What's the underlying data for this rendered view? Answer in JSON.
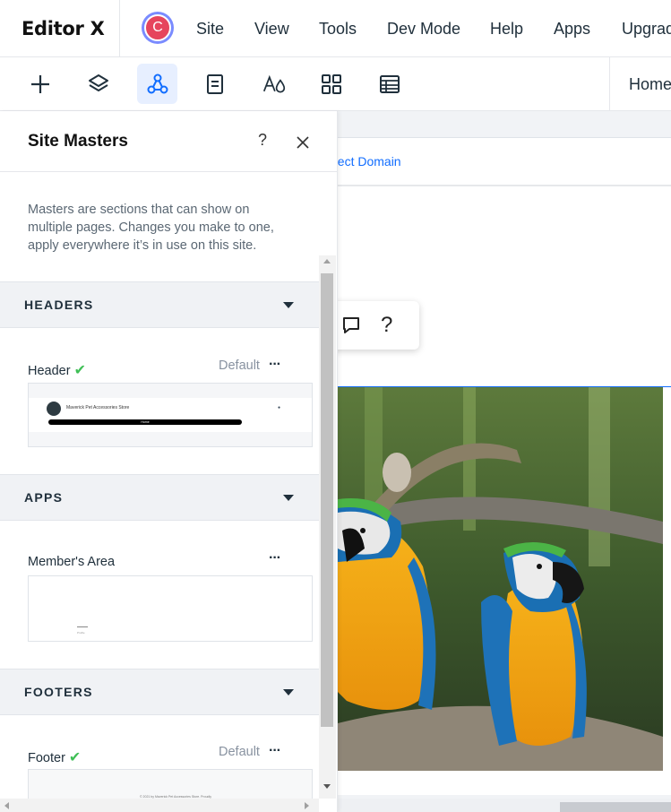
{
  "app": {
    "logo": "Editor X",
    "avatar_letter": "C"
  },
  "menu": [
    "Site",
    "View",
    "Tools",
    "Dev Mode",
    "Help",
    "Apps",
    "Upgrade"
  ],
  "toolbar": {
    "tools": [
      {
        "icon": "add-icon"
      },
      {
        "icon": "layers-icon"
      },
      {
        "icon": "site-masters-icon",
        "active": true
      },
      {
        "icon": "pages-icon"
      },
      {
        "icon": "theme-icon"
      },
      {
        "icon": "apps-grid-icon"
      },
      {
        "icon": "cms-table-icon"
      }
    ],
    "page_selector": "Home"
  },
  "panel": {
    "title": "Site Masters",
    "help": "?",
    "description": "Masters are sections that can show on multiple pages. Changes you make to one, apply everywhere it’s in use on this site.",
    "sections": [
      {
        "title": "HEADERS",
        "item": {
          "name": "Header",
          "default_label": "Default",
          "thumb_store": "Maverick Pet Accessories Store",
          "thumb_nav": "Home"
        }
      },
      {
        "title": "APPS",
        "item": {
          "name": "Member's Area",
          "thumb_caption": "Profile"
        }
      },
      {
        "title": "FOOTERS",
        "item": {
          "name": "Footer",
          "default_label": "Default",
          "thumb_text": "© 2021 by Maverick Pet Accessories Store. Proudly"
        }
      }
    ],
    "more_label": "···"
  },
  "canvas": {
    "domain_link": "nect Domain",
    "float_help": "?"
  },
  "colors": {
    "accent": "#116dff",
    "check": "#3fbf56",
    "active_tool_bg": "#e7efff"
  }
}
